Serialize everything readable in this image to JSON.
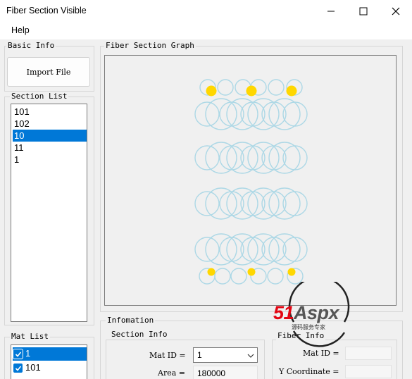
{
  "window": {
    "title": "Fiber Section Visible"
  },
  "menu": {
    "help": "Help"
  },
  "basic_info": {
    "title": "Basic Info",
    "import_button": "Import File"
  },
  "section_list": {
    "title": "Section List",
    "items": [
      "101",
      "102",
      "10",
      "11",
      "1"
    ],
    "selected_index": 2
  },
  "mat_list": {
    "title": "Mat List",
    "items": [
      {
        "label": "1",
        "checked": true,
        "selected": true
      },
      {
        "label": "101",
        "checked": true,
        "selected": false
      }
    ]
  },
  "graph": {
    "title": "Fiber Section Graph",
    "circle_color": "#add8e6",
    "dot_color": "#ffd700"
  },
  "infomation": {
    "title": "Infomation"
  },
  "section_info": {
    "title": "Section Info",
    "mat_id_label": "Mat ID =",
    "mat_id_value": "1",
    "area_label": "Area =",
    "area_value": "180000"
  },
  "fiber_info": {
    "title": "Fiber Info",
    "mat_id_label": "Mat ID =",
    "y_coord_label": "Y Coordinate ="
  },
  "watermark": {
    "brand": "51Aspx",
    "tagline": "源码服务专家"
  }
}
